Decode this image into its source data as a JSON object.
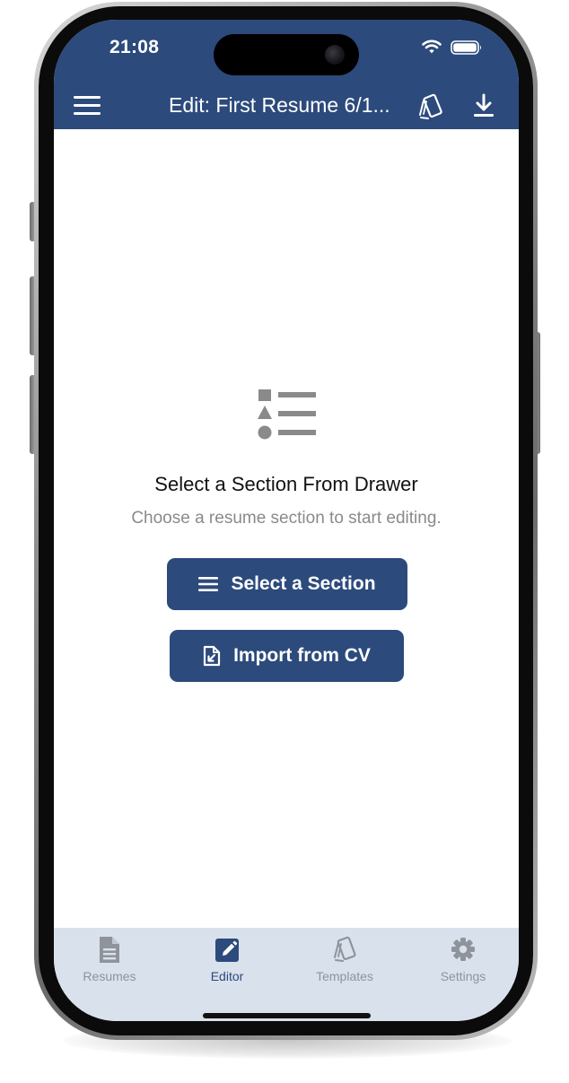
{
  "status_bar": {
    "time": "21:08"
  },
  "app_bar": {
    "title": "Edit: First Resume 6/1...",
    "menu_icon": "hamburger-menu-icon",
    "templates_icon": "cards-icon",
    "download_icon": "download-icon"
  },
  "empty_state": {
    "icon": "shapes-list-icon",
    "title": "Select a Section From Drawer",
    "subtitle": "Choose a resume section to start editing.",
    "select_button_label": "Select a Section",
    "import_button_label": "Import from CV"
  },
  "tabs": [
    {
      "label": "Resumes",
      "icon": "document-icon",
      "active": false
    },
    {
      "label": "Editor",
      "icon": "edit-icon",
      "active": true
    },
    {
      "label": "Templates",
      "icon": "cards-icon",
      "active": false
    },
    {
      "label": "Settings",
      "icon": "gear-icon",
      "active": false
    }
  ],
  "colors": {
    "primary": "#2c4a7c",
    "tab_bar_bg": "#d9e1ec",
    "inactive_tab": "#8f949b",
    "empty_icon": "#8a8a8a"
  }
}
